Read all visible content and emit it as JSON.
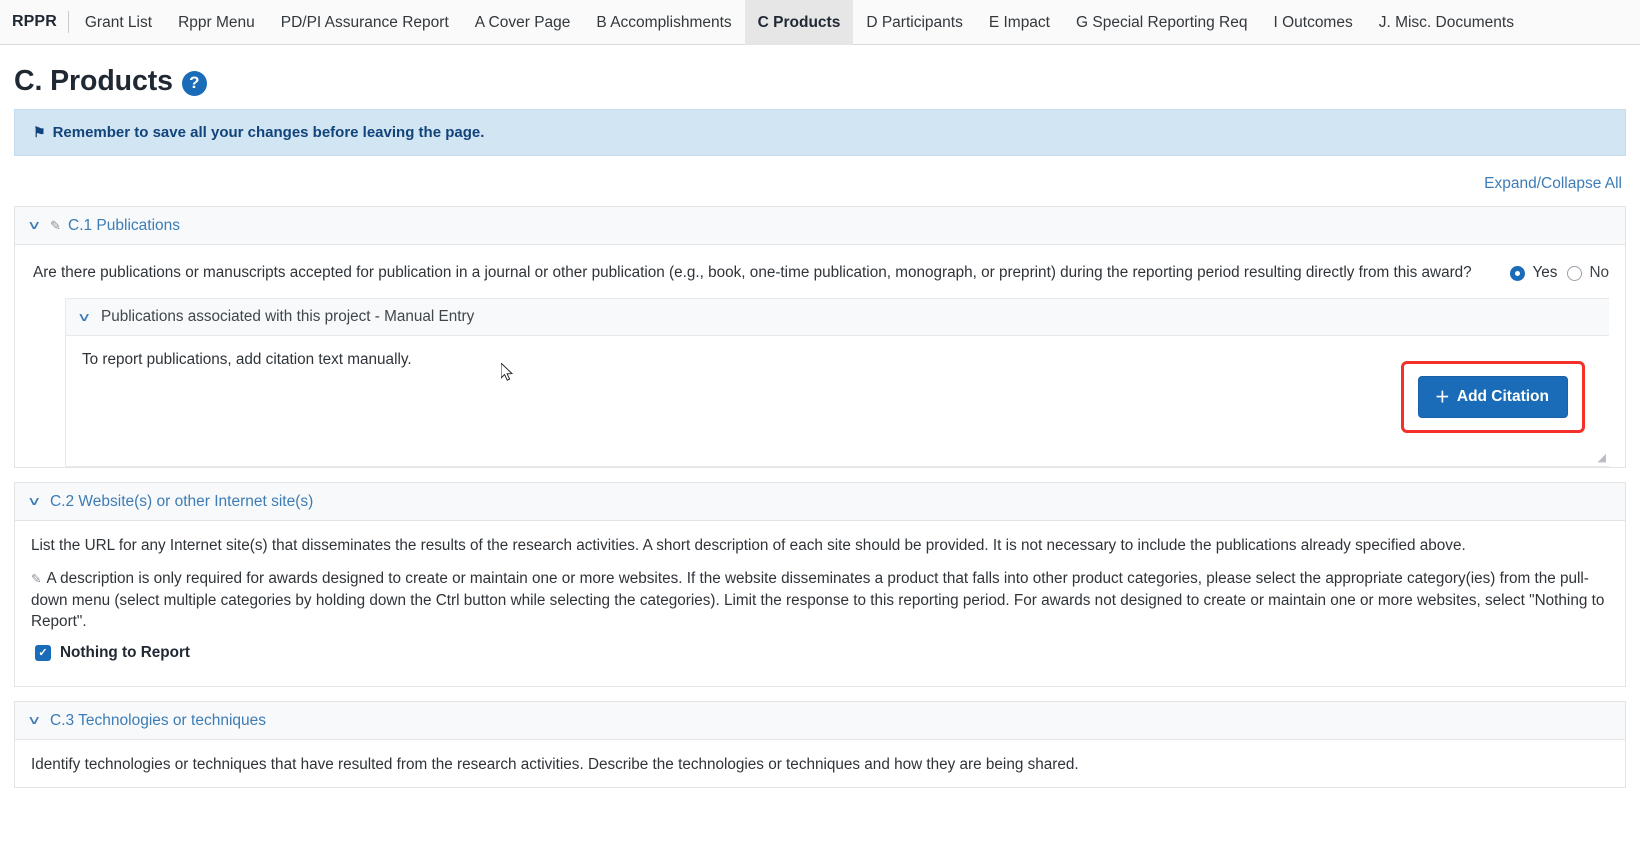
{
  "nav": {
    "brand": "RPPR",
    "items": [
      {
        "label": "Grant List",
        "active": false
      },
      {
        "label": "Rppr Menu",
        "active": false
      },
      {
        "label": "PD/PI Assurance Report",
        "active": false
      },
      {
        "label": "A Cover Page",
        "active": false
      },
      {
        "label": "B Accomplishments",
        "active": false
      },
      {
        "label": "C Products",
        "active": true
      },
      {
        "label": "D Participants",
        "active": false
      },
      {
        "label": "E Impact",
        "active": false
      },
      {
        "label": "G Special Reporting Req",
        "active": false
      },
      {
        "label": "I Outcomes",
        "active": false
      },
      {
        "label": "J. Misc. Documents",
        "active": false
      }
    ]
  },
  "header": {
    "title": "C. Products",
    "help_icon": "question-mark-icon",
    "help_glyph": "?"
  },
  "alert": {
    "icon": "bell-icon",
    "icon_glyph": "⚑",
    "text": "Remember to save all your changes before leaving the page."
  },
  "expand_collapse": {
    "label": "Expand/Collapse All"
  },
  "sections": {
    "c1": {
      "chevron": "∨",
      "pencil_icon": "pencil-icon",
      "pencil_glyph": "✎",
      "title": "C.1 Publications",
      "question": "Are there publications or manuscripts accepted for publication in a journal or other publication (e.g., book, one-time publication, monograph, or preprint) during the reporting period resulting directly from this award?",
      "radio_yes": "Yes",
      "radio_no": "No",
      "radio_selected": "Yes",
      "subpanel": {
        "chevron": "∨",
        "title": "Publications associated with this project - Manual Entry",
        "note": "To report publications, add citation text manually.",
        "add_button": {
          "plus": "＋",
          "label": "Add Citation",
          "highlight_color": "#f4302b"
        }
      }
    },
    "c2": {
      "chevron": "∨",
      "title": "C.2 Website(s) or other Internet site(s)",
      "paragraph1": "List the URL for any Internet site(s) that disseminates the results of the research activities. A short description of each site should be provided. It is not necessary to include the publications already specified above.",
      "note_icon": "pencil-icon",
      "note_glyph": "✎",
      "paragraph2": "A description is only required for awards designed to create or maintain one or more websites. If the website disseminates a product that falls into other product categories, please select the appropriate category(ies) from the pull-down menu (select multiple categories by holding down the Ctrl button while selecting the categories). Limit the response to this reporting period. For awards not designed to create or maintain one or more websites, select \"Nothing to Report\".",
      "nothing_to_report": {
        "label": "Nothing to Report",
        "checked": true
      }
    },
    "c3": {
      "chevron": "∨",
      "title": "C.3 Technologies or techniques",
      "paragraph1": "Identify technologies or techniques that have resulted from the research activities. Describe the technologies or techniques and how they are being shared."
    }
  },
  "colors": {
    "accent": "#1a6bb8",
    "link": "#3d7cb4",
    "alert_bg": "#d2e5f3",
    "highlight": "#f4302b"
  }
}
